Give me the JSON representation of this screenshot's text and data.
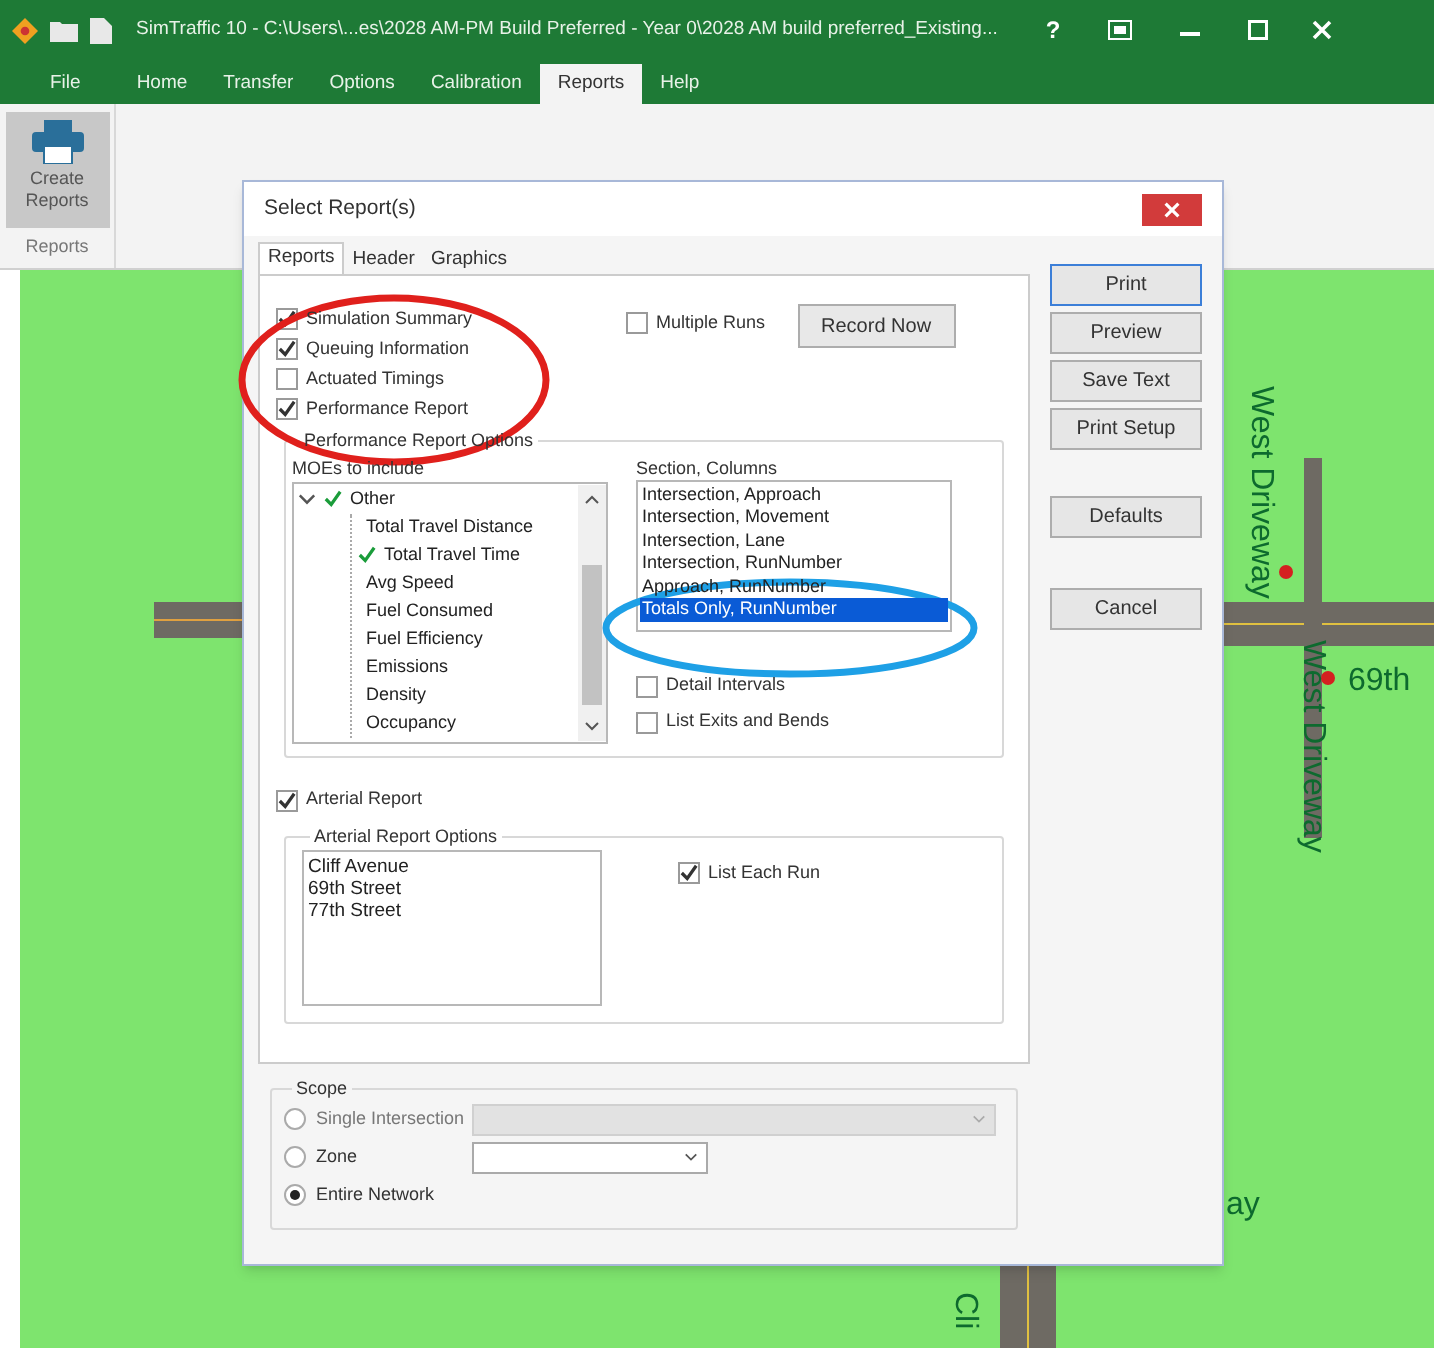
{
  "window": {
    "title": "SimTraffic 10 - C:\\Users\\...es\\2028 AM-PM Build Preferred - Year 0\\2028 AM build preferred_Existing...",
    "help": "?"
  },
  "menu_tabs": [
    {
      "label": "File",
      "selected": false
    },
    {
      "label": "Home",
      "selected": false
    },
    {
      "label": "Transfer",
      "selected": false
    },
    {
      "label": "Options",
      "selected": false
    },
    {
      "label": "Calibration",
      "selected": false
    },
    {
      "label": "Reports",
      "selected": true
    },
    {
      "label": "Help",
      "selected": false
    }
  ],
  "ribbon": {
    "button": "Create Reports",
    "group": "Reports"
  },
  "map": {
    "labels": [
      {
        "text": "West Driveway",
        "vertical": true
      },
      {
        "text": "West Driveway",
        "vertical": true
      },
      {
        "text": "69th",
        "vertical": false
      },
      {
        "text": "ay",
        "vertical": false
      },
      {
        "text": "Cli",
        "vertical": true
      }
    ]
  },
  "dialog": {
    "title": "Select Report(s)",
    "tabs": [
      {
        "label": "Reports",
        "selected": true
      },
      {
        "label": "Header",
        "selected": false
      },
      {
        "label": "Graphics",
        "selected": false
      }
    ],
    "reports": [
      {
        "label": "Simulation Summary",
        "checked": true
      },
      {
        "label": "Queuing Information",
        "checked": true
      },
      {
        "label": "Actuated Timings",
        "checked": false
      },
      {
        "label": "Performance Report",
        "checked": true
      }
    ],
    "multiple_runs": {
      "label": "Multiple Runs",
      "checked": false
    },
    "record_button": "Record Now",
    "performance_options": {
      "title": "Performance Report Options",
      "moes_label": "MOEs to include",
      "tree": [
        {
          "label": "Other",
          "checked": true,
          "expanded": true,
          "children": [
            {
              "label": "Total Travel Distance",
              "checked": false
            },
            {
              "label": "Total Travel Time",
              "checked": true
            },
            {
              "label": "Avg Speed",
              "checked": false
            },
            {
              "label": "Fuel Consumed",
              "checked": false
            },
            {
              "label": "Fuel Efficiency",
              "checked": false
            },
            {
              "label": "Emissions",
              "checked": false
            },
            {
              "label": "Density",
              "checked": false
            },
            {
              "label": "Occupancy",
              "checked": false
            }
          ]
        }
      ],
      "columns_label": "Section, Columns",
      "columns": [
        {
          "label": "Intersection, Approach",
          "selected": false
        },
        {
          "label": "Intersection, Movement",
          "selected": false
        },
        {
          "label": "Intersection, Lane",
          "selected": false
        },
        {
          "label": "Intersection, RunNumber",
          "selected": false
        },
        {
          "label": "Approach, RunNumber",
          "selected": false
        },
        {
          "label": "Totals Only, RunNumber",
          "selected": true
        }
      ],
      "options": [
        {
          "label": "Detail Intervals",
          "checked": false
        },
        {
          "label": "List Exits and Bends",
          "checked": false
        }
      ]
    },
    "arterial_report": {
      "label": "Arterial Report",
      "checked": true
    },
    "arterial_options": {
      "title": "Arterial Report Options",
      "arterials": [
        "Cliff Avenue",
        "69th Street",
        "77th Street"
      ],
      "list_each_run": {
        "label": "List Each Run",
        "checked": true
      }
    },
    "scope": {
      "title": "Scope",
      "options": [
        {
          "label": "Single Intersection",
          "selected": false,
          "kind": "wide_dropdown",
          "disabled": true
        },
        {
          "label": "Zone",
          "selected": false,
          "kind": "dropdown",
          "disabled": false
        },
        {
          "label": "Entire Network",
          "selected": true,
          "kind": "plain",
          "disabled": false
        }
      ]
    },
    "buttons": [
      {
        "label": "Print",
        "default": true
      },
      {
        "label": "Preview",
        "default": false
      },
      {
        "label": "Save Text",
        "default": false
      },
      {
        "label": "Print Setup",
        "default": false
      },
      {
        "label": "Defaults",
        "default": false
      },
      {
        "label": "Cancel",
        "default": false
      }
    ]
  }
}
